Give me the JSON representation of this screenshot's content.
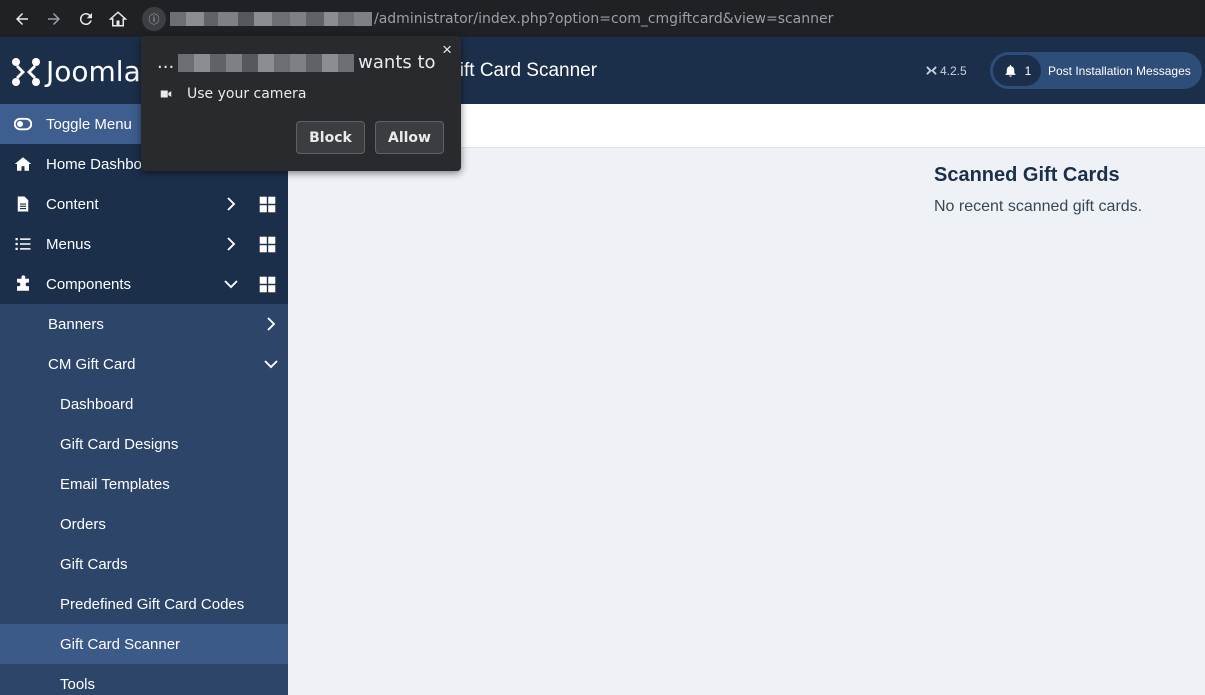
{
  "browser": {
    "url_visible": "/administrator/index.php?option=com_cmgiftcard&view=scanner"
  },
  "header": {
    "logo_text": "Joomla",
    "page_title": "Gift Card Scanner",
    "version": "4.2.5",
    "notifications_count": "1",
    "post_install_label": "Post Installation Messages"
  },
  "sidebar": {
    "toggle": "Toggle Menu",
    "items": [
      {
        "label": "Home Dashboard",
        "icon": "home-icon"
      },
      {
        "label": "Content",
        "icon": "file-icon"
      },
      {
        "label": "Menus",
        "icon": "list-icon"
      },
      {
        "label": "Components",
        "icon": "puzzle-icon"
      }
    ],
    "components_sub": [
      {
        "label": "Banners"
      },
      {
        "label": "CM Gift Card"
      }
    ],
    "giftcard_sub": [
      {
        "label": "Dashboard"
      },
      {
        "label": "Gift Card Designs"
      },
      {
        "label": "Email Templates"
      },
      {
        "label": "Orders"
      },
      {
        "label": "Gift Cards"
      },
      {
        "label": "Predefined Gift Card Codes"
      },
      {
        "label": "Gift Card Scanner"
      },
      {
        "label": "Tools"
      }
    ]
  },
  "main": {
    "scanned_title": "Scanned Gift Cards",
    "scanned_empty": "No recent scanned gift cards."
  },
  "permission_popup": {
    "prefix": "...",
    "suffix": "wants to",
    "request": "Use your camera",
    "close": "×",
    "block_label": "Block",
    "allow_label": "Allow"
  }
}
